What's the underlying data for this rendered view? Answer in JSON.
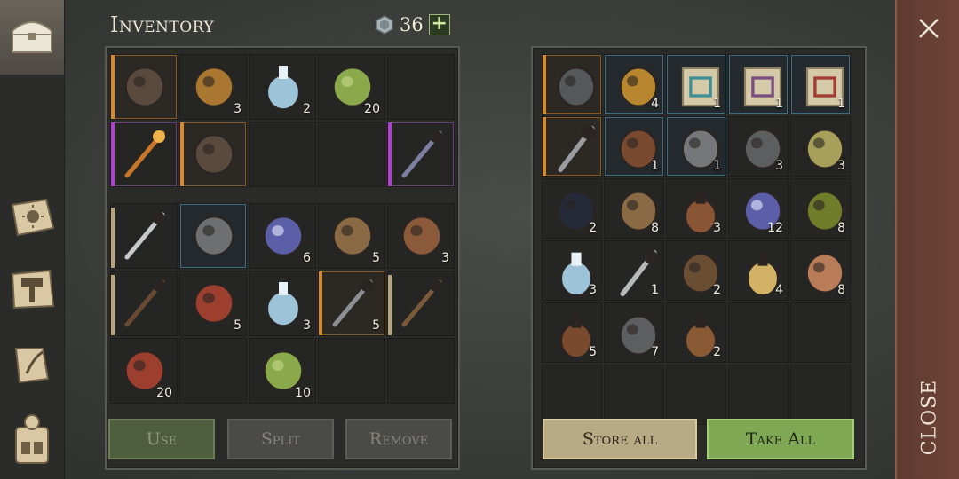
{
  "inventory": {
    "title": "Inventory",
    "currency": "36",
    "equip_rows": [
      [
        {
          "name": "leather-boots",
          "rarity": "orange",
          "count": ""
        },
        {
          "name": "bronze-ingot",
          "rarity": "",
          "count": "3"
        },
        {
          "name": "potion-flask",
          "rarity": "",
          "count": "2"
        },
        {
          "name": "green-herbs",
          "rarity": "",
          "count": "20"
        },
        {
          "name": "empty",
          "rarity": "",
          "count": ""
        }
      ],
      [
        {
          "name": "flame-mace",
          "rarity": "purple",
          "count": ""
        },
        {
          "name": "leather-boots",
          "rarity": "orange",
          "count": ""
        },
        {
          "name": "empty",
          "rarity": "",
          "count": ""
        },
        {
          "name": "empty",
          "rarity": "",
          "count": ""
        },
        {
          "name": "scythe-pickaxe",
          "rarity": "purple",
          "count": ""
        }
      ]
    ],
    "bag_rows": [
      [
        {
          "name": "long-sword",
          "rarity": "tan",
          "count": ""
        },
        {
          "name": "iron-helmet",
          "rarity": "blue",
          "count": ""
        },
        {
          "name": "crystal-shard",
          "rarity": "",
          "count": "6"
        },
        {
          "name": "grain-sack",
          "rarity": "",
          "count": "5"
        },
        {
          "name": "iron-nails",
          "rarity": "",
          "count": "3"
        }
      ],
      [
        {
          "name": "spiked-mace",
          "rarity": "tan",
          "count": ""
        },
        {
          "name": "raw-meat",
          "rarity": "",
          "count": "5"
        },
        {
          "name": "potion-flask",
          "rarity": "",
          "count": "3"
        },
        {
          "name": "halberd",
          "rarity": "orange",
          "count": "5"
        },
        {
          "name": "spiked-club",
          "rarity": "tan",
          "count": ""
        }
      ],
      [
        {
          "name": "raw-meat",
          "rarity": "",
          "count": "20"
        },
        {
          "name": "empty",
          "rarity": "",
          "count": ""
        },
        {
          "name": "green-herbs",
          "rarity": "",
          "count": "10"
        },
        {
          "name": "empty",
          "rarity": "",
          "count": ""
        },
        {
          "name": "empty",
          "rarity": "",
          "count": ""
        }
      ]
    ],
    "buttons": {
      "use": "Use",
      "split": "Split",
      "remove": "Remove"
    }
  },
  "storage": {
    "rows": [
      [
        {
          "name": "chainmail-armor",
          "rarity": "orange",
          "count": ""
        },
        {
          "name": "golden-bell",
          "rarity": "blue",
          "count": "4"
        },
        {
          "name": "blue-recipe-scroll",
          "rarity": "blue",
          "count": "1"
        },
        {
          "name": "purple-recipe-scroll",
          "rarity": "blue",
          "count": "1"
        },
        {
          "name": "red-recipe-scroll",
          "rarity": "blue",
          "count": "1"
        }
      ],
      [
        {
          "name": "battle-axe",
          "rarity": "orange",
          "count": ""
        },
        {
          "name": "leather-collar",
          "rarity": "blue",
          "count": "1"
        },
        {
          "name": "iron-horseshoe",
          "rarity": "blue",
          "count": "1"
        },
        {
          "name": "iron-gear",
          "rarity": "",
          "count": "3"
        },
        {
          "name": "sand-pile",
          "rarity": "",
          "count": "3"
        }
      ],
      [
        {
          "name": "coal-chunks",
          "rarity": "",
          "count": "2"
        },
        {
          "name": "grain-sack",
          "rarity": "",
          "count": "8"
        },
        {
          "name": "clay-bottle",
          "rarity": "",
          "count": "3"
        },
        {
          "name": "crystal-shard",
          "rarity": "",
          "count": "12"
        },
        {
          "name": "herb-ball",
          "rarity": "",
          "count": "8"
        }
      ],
      [
        {
          "name": "potion-flask",
          "rarity": "",
          "count": "3"
        },
        {
          "name": "iron-fork",
          "rarity": "",
          "count": "1"
        },
        {
          "name": "bear-trap",
          "rarity": "",
          "count": "2"
        },
        {
          "name": "wax-candle",
          "rarity": "",
          "count": "4"
        },
        {
          "name": "cloth-fabric",
          "rarity": "",
          "count": "8"
        }
      ],
      [
        {
          "name": "wooden-mug",
          "rarity": "",
          "count": "5"
        },
        {
          "name": "iron-chain",
          "rarity": "",
          "count": "7"
        },
        {
          "name": "wooden-barrel",
          "rarity": "",
          "count": "2"
        },
        {
          "name": "empty",
          "rarity": "",
          "count": ""
        },
        {
          "name": "empty",
          "rarity": "",
          "count": ""
        }
      ],
      [
        {
          "name": "empty",
          "rarity": "",
          "count": ""
        },
        {
          "name": "empty",
          "rarity": "",
          "count": ""
        },
        {
          "name": "empty",
          "rarity": "",
          "count": ""
        },
        {
          "name": "empty",
          "rarity": "",
          "count": ""
        },
        {
          "name": "empty",
          "rarity": "",
          "count": ""
        }
      ]
    ],
    "buttons": {
      "store_all": "Store all",
      "take_all": "Take All"
    }
  },
  "close": {
    "label": "CLOSE"
  },
  "rail_icons": [
    "chest-icon",
    "sun-book-icon",
    "hammer-icon",
    "scroll-icon",
    "backpack-icon"
  ]
}
